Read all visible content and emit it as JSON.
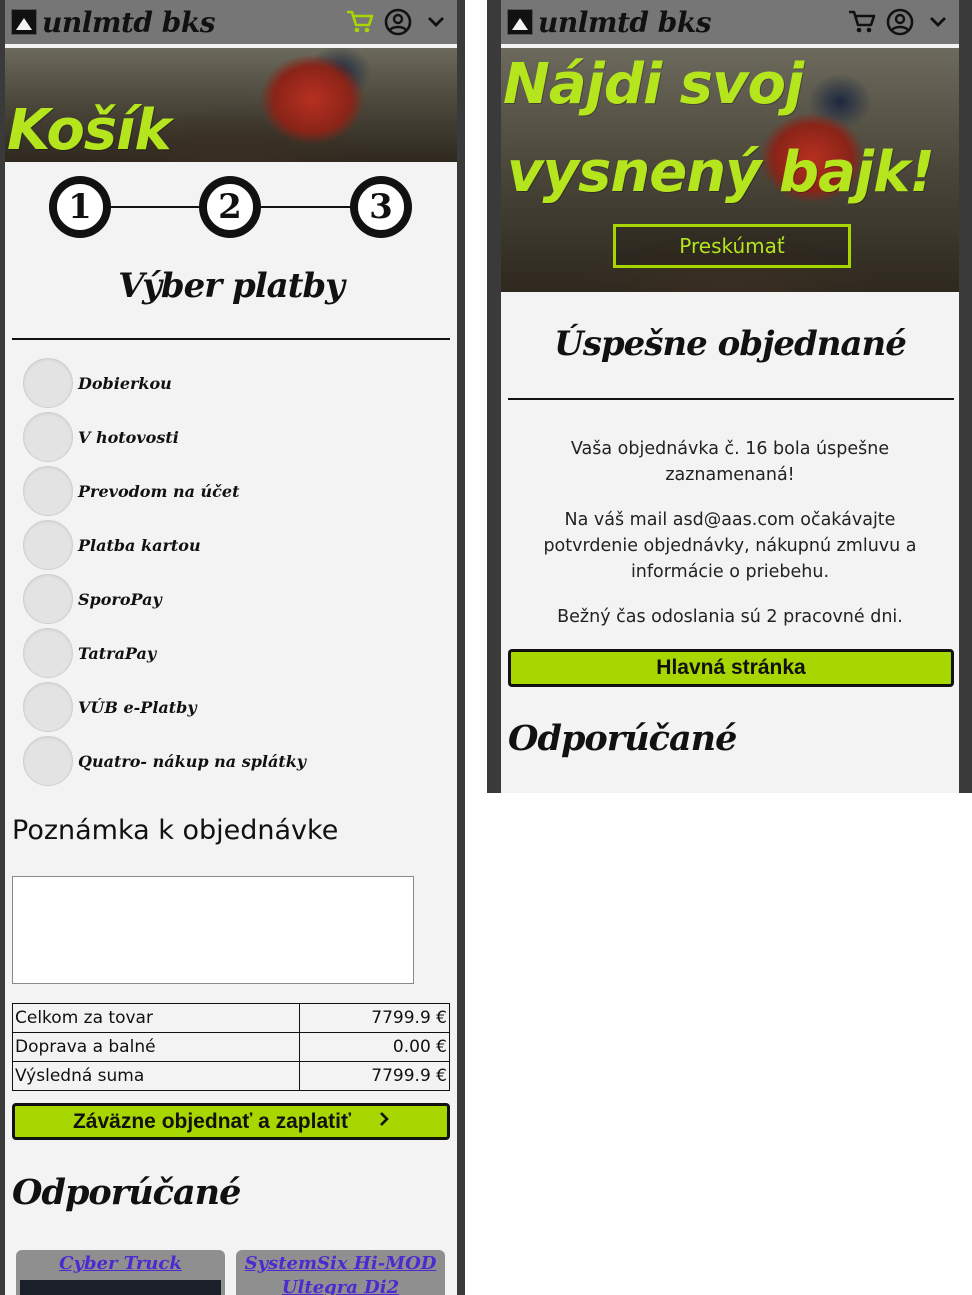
{
  "brand": {
    "name": "unlmtd bks"
  },
  "header_icons": [
    "cart-icon",
    "account-icon",
    "chevron-down-icon"
  ],
  "colors": {
    "accent": "#a7d600",
    "topbar": "#767676",
    "background": "#f3f3f3",
    "frame": "#3a3a3a",
    "link": "#4b2ad1"
  },
  "checkout": {
    "hero_title": "Košík",
    "steps": [
      "1",
      "2",
      "3"
    ],
    "payment_title": "Výber platby",
    "payment_options": [
      {
        "label": "Dobierkou"
      },
      {
        "label": "V hotovosti"
      },
      {
        "label": "Prevodom na účet"
      },
      {
        "label": "Platba kartou"
      },
      {
        "label": "SporoPay"
      },
      {
        "label": "TatraPay"
      },
      {
        "label": "VÚB e-Platby"
      },
      {
        "label": "Quatro- nákup na splátky"
      }
    ],
    "note_label": "Poznámka k objednávke",
    "note_value": "",
    "totals": [
      {
        "label": "Celkom za tovar",
        "value": "7799.9 €"
      },
      {
        "label": "Doprava a balné",
        "value": "0.00 €"
      },
      {
        "label": "Výsledná suma",
        "value": "7799.9 €"
      }
    ],
    "submit_label": "Záväzne objednať a zaplatiť",
    "recommended_title": "Odporúčané",
    "recommended_items": [
      {
        "title": "Cyber Truck"
      },
      {
        "title": "SystemSix Hi-MOD Ultegra Di2"
      }
    ]
  },
  "confirmation": {
    "hero_line1": "Nájdi svoj",
    "hero_line2": "vysnený bajk!",
    "explore_label": "Preskúmať",
    "success_title": "Úspešne objednané",
    "message1": "Vaša objednávka č. 16 bola úspešne zaznamenaná!",
    "message2": "Na váš mail asd@aas.com očakávajte potvrdenie objednávky, nákupnú zmluvu a informácie o priebehu.",
    "message3": "Bežný čas odoslania sú 2 pracovné dni.",
    "home_label": "Hlavná stránka",
    "recommended_title": "Odporúčané"
  }
}
